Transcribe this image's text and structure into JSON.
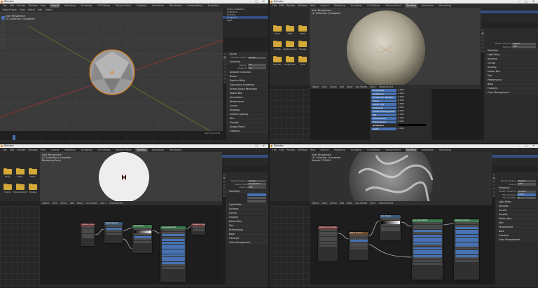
{
  "app": {
    "title": "Blender"
  },
  "menus": [
    "File",
    "Edit",
    "Render",
    "Window",
    "Help"
  ],
  "workspaces": [
    "Layout",
    "Modeling",
    "Sculpting",
    "UV Editing",
    "Texture Paint",
    "Shading",
    "Animation",
    "Rendering",
    "Compositing",
    "Scripting"
  ],
  "quads": [
    {
      "active_workspace": "Layout",
      "viewport_overlay": [
        "User Perspective",
        "(1) Collection | Icosphere"
      ],
      "viewport_header": [
        "Object Mode",
        "View",
        "Select",
        "Add",
        "Object"
      ],
      "outliner_rows": [
        "Scene Collection",
        "Collection",
        "Camera",
        "Icosphere",
        "Light"
      ],
      "props_panels": [
        "Scene",
        "Render Engine",
        "Sampling",
        "Ambient Occlusion",
        "Bloom",
        "Depth of Field",
        "Subsurface Scattering",
        "Screen Space Refraction",
        "Motion Blur",
        "Volumetrics",
        "Performance",
        "Curves",
        "Shadows",
        "Indirect Lighting",
        "Film",
        "Simplify",
        "Grease Pencil",
        "Freestyle"
      ],
      "props_fields": [
        {
          "label": "Render Engine",
          "value": "Eevee"
        },
        {
          "label": "Render",
          "value": "64"
        },
        {
          "label": "Viewport",
          "value": "16"
        }
      ],
      "timeline_label": "Start 1  End 250"
    },
    {
      "active_workspace": "Shading",
      "viewport_overlay": [
        "User Perspective",
        "(1) Collection | Icosphere"
      ],
      "filebrowser_folders": [
        "Wrap",
        "Nulls",
        "Mask",
        "Cracks",
        "Displacement",
        "Orange",
        "Normals",
        "Roughness",
        "Tiles"
      ],
      "props_fields": [
        {
          "label": "Render Engine",
          "value": "Cycles"
        },
        {
          "label": "Device",
          "value": "CPU"
        }
      ],
      "props_panels": [
        "Sampling",
        "Light Paths",
        "Volumes",
        "Curves",
        "Simplify",
        "Motion Blur",
        "Film",
        "Performance",
        "Bake",
        "Freestyle",
        "Color Management"
      ],
      "node_header": [
        "Object",
        "View",
        "Select",
        "Add",
        "Node",
        "Use Nodes",
        "Slot 1",
        "Material.001"
      ],
      "bsdf_rows": [
        {
          "key": "Roughness",
          "value": "0.500"
        },
        {
          "key": "Anisotropic",
          "value": "0.000"
        },
        {
          "key": "Anisotropic Rotation",
          "value": "0.000"
        },
        {
          "key": "Sheen",
          "value": "0.000"
        },
        {
          "key": "Sheen Tint",
          "value": "0.500"
        },
        {
          "key": "Clearcoat",
          "value": "0.000"
        },
        {
          "key": "Clearcoat Roughness",
          "value": "0.030"
        },
        {
          "key": "IOR",
          "value": "1.450"
        },
        {
          "key": "Transmission",
          "value": "0.000"
        },
        {
          "key": "Transmission Roughness",
          "value": "0.000"
        },
        {
          "key": "Emission",
          "value": ""
        },
        {
          "key": "Alpha",
          "value": "1.000"
        }
      ]
    },
    {
      "active_workspace": "Shading",
      "viewport_overlay": [
        "User Perspective",
        "(1) Collection | Icosphere",
        "Rendering Done"
      ],
      "filebrowser_folders": [
        "Wrap",
        "Nulls",
        "Mask",
        "Cracks",
        "Displacement",
        "Orange"
      ],
      "props_fields": [
        {
          "label": "Render Engine",
          "value": "Cycles"
        },
        {
          "label": "Feature Set",
          "value": "Supported"
        },
        {
          "label": "Device",
          "value": "CPU"
        }
      ],
      "props_panels": [
        "Sampling",
        "Light Paths",
        "Volumes",
        "Curves",
        "Simplify",
        "Motion Blur",
        "Film",
        "Performance",
        "Bake",
        "Freestyle",
        "Color Management"
      ],
      "node_header": [
        "Object",
        "View",
        "Select",
        "Add",
        "Node",
        "Use Nodes",
        "Slot 1",
        "Material.001"
      ],
      "nodes": [
        {
          "title": "Texture Coordinate",
          "color": "#7a3a3a"
        },
        {
          "title": "Noise Texture",
          "color": "#6a4a2a"
        },
        {
          "title": "ColorRamp",
          "color": "#3a5a7a"
        },
        {
          "title": "Principled BSDF",
          "color": "#3a7a4a"
        },
        {
          "title": "Material Output",
          "color": "#7a3a3a"
        }
      ]
    },
    {
      "active_workspace": "Shading",
      "viewport_overlay": [
        "User Perspective",
        "(1) Collection | Icosphere",
        "Sample 27/1024"
      ],
      "props_fields": [
        {
          "label": "Render Engine",
          "value": "Cycles"
        },
        {
          "label": "Device",
          "value": "CPU"
        },
        {
          "label": "Noise Threshold",
          "value": "0.0100"
        },
        {
          "label": "Max Samples",
          "value": "1024"
        },
        {
          "label": "Min Samples",
          "value": "0"
        }
      ],
      "props_panels": [
        "Sampling",
        "Light Paths",
        "Volumes",
        "Curves",
        "Simplify",
        "Motion Blur",
        "Film",
        "Performance",
        "Bake",
        "Freestyle",
        "Color Management"
      ],
      "node_header": [
        "Object",
        "View",
        "Select",
        "Add",
        "Node",
        "Use Nodes",
        "Slot 1",
        "Material.001"
      ],
      "nodes": [
        {
          "title": "Texture Coordinate",
          "color": "#7a3a3a"
        },
        {
          "title": "Noise Texture",
          "color": "#6a4a2a"
        },
        {
          "title": "ColorRamp",
          "color": "#3a5a7a"
        },
        {
          "title": "Principled BSDF",
          "color": "#3a7a4a"
        },
        {
          "title": "Material Output",
          "color": "#7a3a3a"
        }
      ]
    }
  ],
  "colors": {
    "accent": "#4772b3",
    "selection": "#e87d0d",
    "folder": "#d4a93a"
  }
}
